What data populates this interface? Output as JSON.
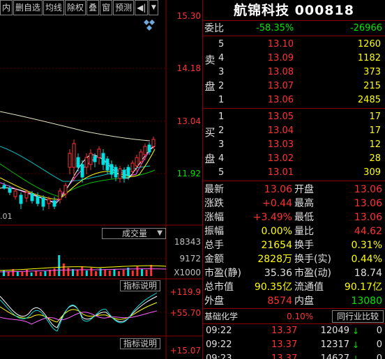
{
  "toolbar": {
    "buttons": [
      "内",
      "删自选",
      "均线",
      "除权",
      "叠",
      "窗",
      "预测"
    ],
    "speaker_glyph": "◀|",
    "dropdown_glyph": "▼"
  },
  "chart": {
    "price_ticks": [
      "15.30",
      "14.18",
      "13.04",
      "11.92"
    ],
    "date_label": ".01",
    "volume_panel_label": "成交量",
    "volume_ticks": [
      "18343",
      "9172",
      "X1000"
    ],
    "indicator_panel_label": "指标说明",
    "indicator_ticks": [
      "+119.9",
      "+55.70"
    ],
    "indicator_panel2_label": "指标说明",
    "indicator2_ticks": [
      "+15.07"
    ]
  },
  "quote": {
    "title": "航锦科技 000818",
    "weibi": {
      "label": "委比",
      "pct": "-58.35%",
      "diff": "-26966"
    },
    "sell_side_label": [
      "卖",
      "盘"
    ],
    "buy_side_label": [
      "买",
      "盘"
    ],
    "sell": [
      {
        "level": "5",
        "price": "13.10",
        "vol": "1260"
      },
      {
        "level": "4",
        "price": "13.09",
        "vol": "1182"
      },
      {
        "level": "3",
        "price": "13.08",
        "vol": "373"
      },
      {
        "level": "2",
        "price": "13.07",
        "vol": "215"
      },
      {
        "level": "1",
        "price": "13.06",
        "vol": "2485"
      }
    ],
    "buy": [
      {
        "level": "1",
        "price": "13.05",
        "vol": "17"
      },
      {
        "level": "2",
        "price": "13.04",
        "vol": "17"
      },
      {
        "level": "3",
        "price": "13.03",
        "vol": "12"
      },
      {
        "level": "4",
        "price": "13.02",
        "vol": "28"
      },
      {
        "level": "5",
        "price": "13.01",
        "vol": "309"
      }
    ],
    "stats": [
      {
        "l": "最新",
        "lv": "13.06",
        "lc": "red",
        "r": "开盘",
        "rv": "13.06",
        "rc": "red"
      },
      {
        "l": "涨跌",
        "lv": "+0.44",
        "lc": "red",
        "r": "最高",
        "rv": "13.06",
        "rc": "red"
      },
      {
        "l": "涨幅",
        "lv": "+3.49%",
        "lc": "red",
        "r": "最低",
        "rv": "13.06",
        "rc": "red"
      },
      {
        "l": "振幅",
        "lv": "0.00%",
        "lc": "yellow",
        "r": "量比",
        "rv": "44.62",
        "rc": "red"
      },
      {
        "l": "总手",
        "lv": "21654",
        "lc": "yellow",
        "r": "换手",
        "rv": "0.31%",
        "rc": "yellow"
      },
      {
        "l": "金额",
        "lv": "2828万",
        "lc": "yellow",
        "r": "换手(实)",
        "rv": "0.44%",
        "rc": "yellow"
      },
      {
        "l": "市盈(静)",
        "lv": "35.36",
        "lc": "white",
        "r": "市盈(动)",
        "rv": "18.74",
        "rc": "white"
      },
      {
        "l": "总市值",
        "lv": "90.35亿",
        "lc": "yellow",
        "r": "流通值",
        "rv": "90.17亿",
        "rc": "yellow"
      },
      {
        "l": "外盘",
        "lv": "8574",
        "lc": "red",
        "r": "内盘",
        "rv": "13080",
        "rc": "green"
      }
    ],
    "industry": {
      "name": "基础化学",
      "pct": "0.10%",
      "button": "同行业比较"
    },
    "ticks": [
      {
        "time": "09:22",
        "price": "13.37",
        "vol": "12049",
        "arrow": "↓",
        "n": "0"
      },
      {
        "time": "09:22",
        "price": "13.37",
        "vol": "12317",
        "arrow": "↓",
        "n": "0"
      },
      {
        "time": "09:23",
        "price": "13.37",
        "vol": "14627",
        "arrow": "↓",
        "n": "0"
      }
    ]
  },
  "colors": {
    "up": "#ff3232",
    "down": "#00e600",
    "border": "#8b0000",
    "volume": "#ffff00"
  }
}
